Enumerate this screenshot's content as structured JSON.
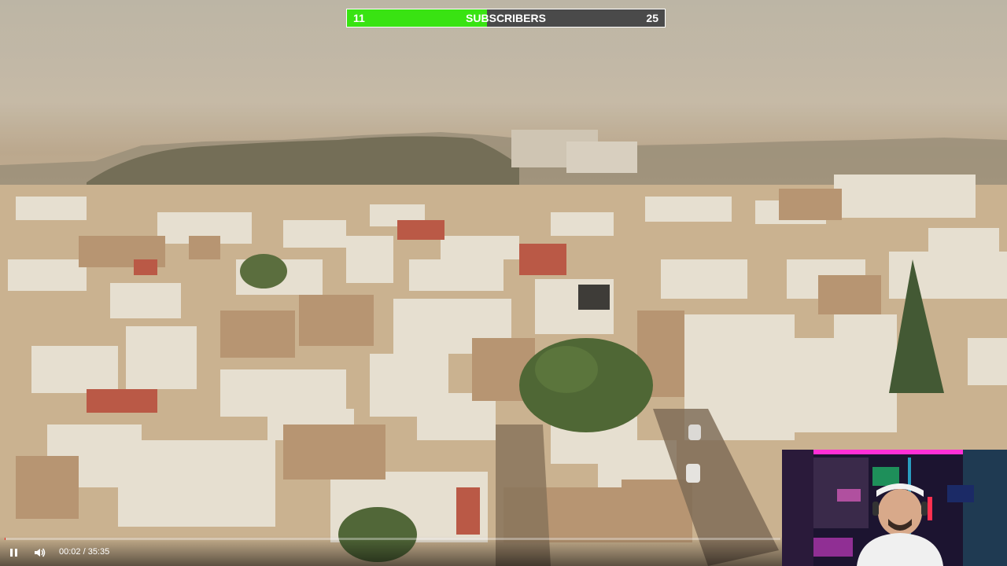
{
  "subscriber_goal": {
    "current": "11",
    "label": "SUBSCRIBERS",
    "goal": "25",
    "progress_fraction": 0.44,
    "fill_color": "#39e312"
  },
  "player": {
    "time_display": "00:02 / 35:35",
    "progress_fraction": 0.001,
    "play_icon": "pause-icon",
    "volume_icon": "volume-icon"
  },
  "webcam_overlay": {
    "accent_colors": [
      "#ff2fd6",
      "#2fd7ff",
      "#7a3cff"
    ]
  }
}
